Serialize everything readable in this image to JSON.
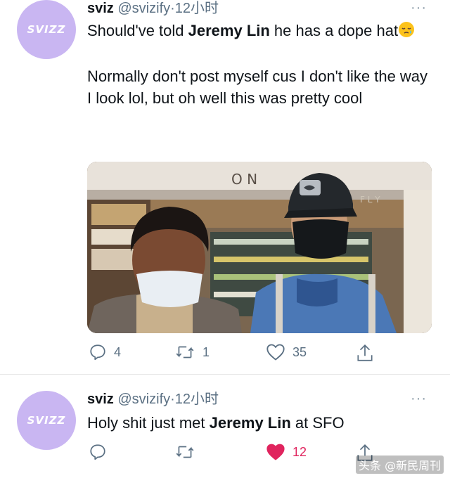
{
  "tweets": [
    {
      "avatar_text": "SVIZZ",
      "name": "sviz",
      "handle": "@svizify",
      "separator": "·",
      "time": "12小时",
      "more": "···",
      "text_1_a": "Should've told ",
      "text_1_b": "Jeremy Lin",
      "text_1_c": " he has a dope hat",
      "text_2": "Normally don't post myself cus I don't like the way I look lol, but oh well this was pretty cool",
      "photo_sign": "O N",
      "photo_sign_right": "F L Y",
      "replies": "4",
      "retweets": "1",
      "likes": "35",
      "liked": false,
      "emoji": "sleepy-face-icon"
    },
    {
      "avatar_text": "SVIZZ",
      "name": "sviz",
      "handle": "@svizify",
      "separator": "·",
      "time": "12小时",
      "more": "···",
      "text_1_a": "Holy shit just met ",
      "text_1_b": "Jeremy Lin",
      "text_1_c": " at SFO",
      "replies": "",
      "retweets": "",
      "likes": "12",
      "liked": true
    }
  ],
  "watermark": "头条 @新民周刊",
  "colors": {
    "avatar": "#c9b6f2",
    "like_active": "#e0245e",
    "secondary": "#5b7083"
  }
}
